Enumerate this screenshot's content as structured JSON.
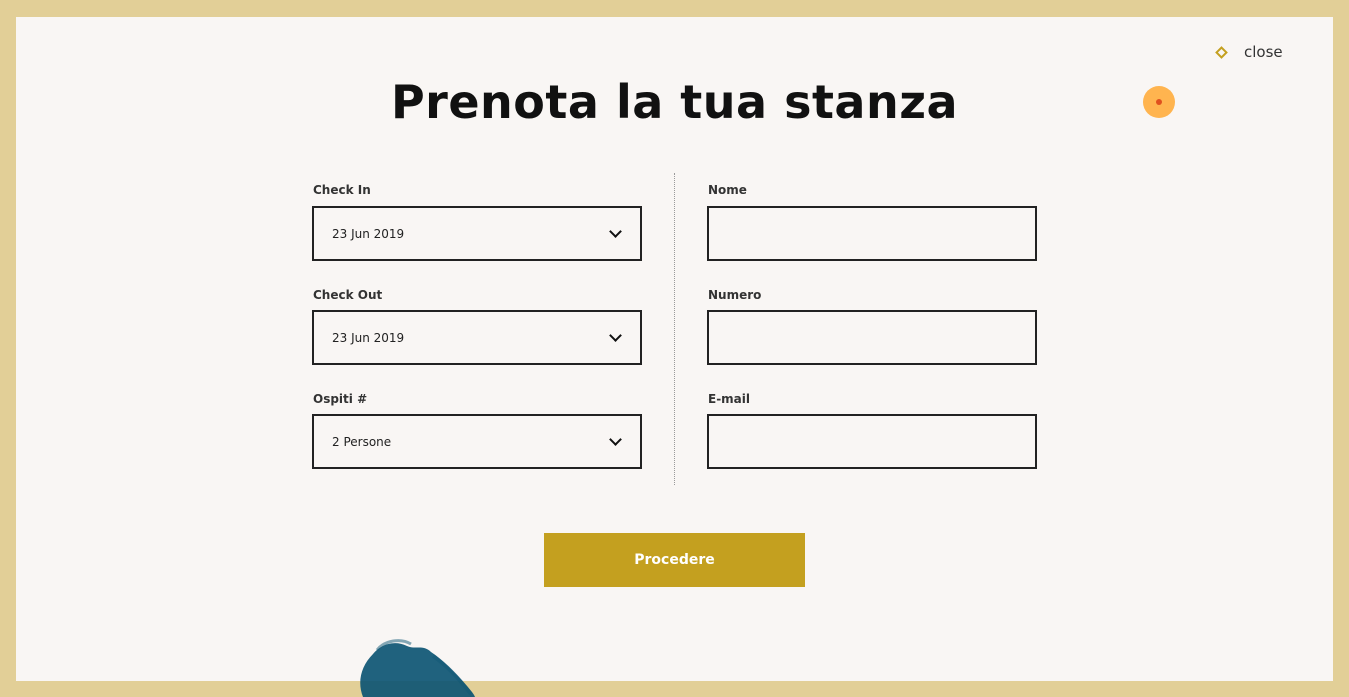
{
  "modal": {
    "title": "Prenota la tua stanza",
    "close_label": "close"
  },
  "form": {
    "left": [
      {
        "label": "Check In",
        "value": "23  Jun  2019"
      },
      {
        "label": "Check Out",
        "value": "23  Jun  2019"
      },
      {
        "label": "Ospiti #",
        "value": "2  Persone"
      }
    ],
    "right": [
      {
        "label": "Nome",
        "value": ""
      },
      {
        "label": "Numero",
        "value": ""
      },
      {
        "label": "E-mail",
        "value": ""
      }
    ],
    "submit_label": "Procedere"
  },
  "colors": {
    "frame": "#e2cf97",
    "background": "#f9f6f4",
    "accent": "#c4a01f",
    "cursor": "#ffb44f",
    "splash": "#0d5573"
  },
  "icons": [
    "diamond-icon",
    "chevron-down-icon"
  ]
}
